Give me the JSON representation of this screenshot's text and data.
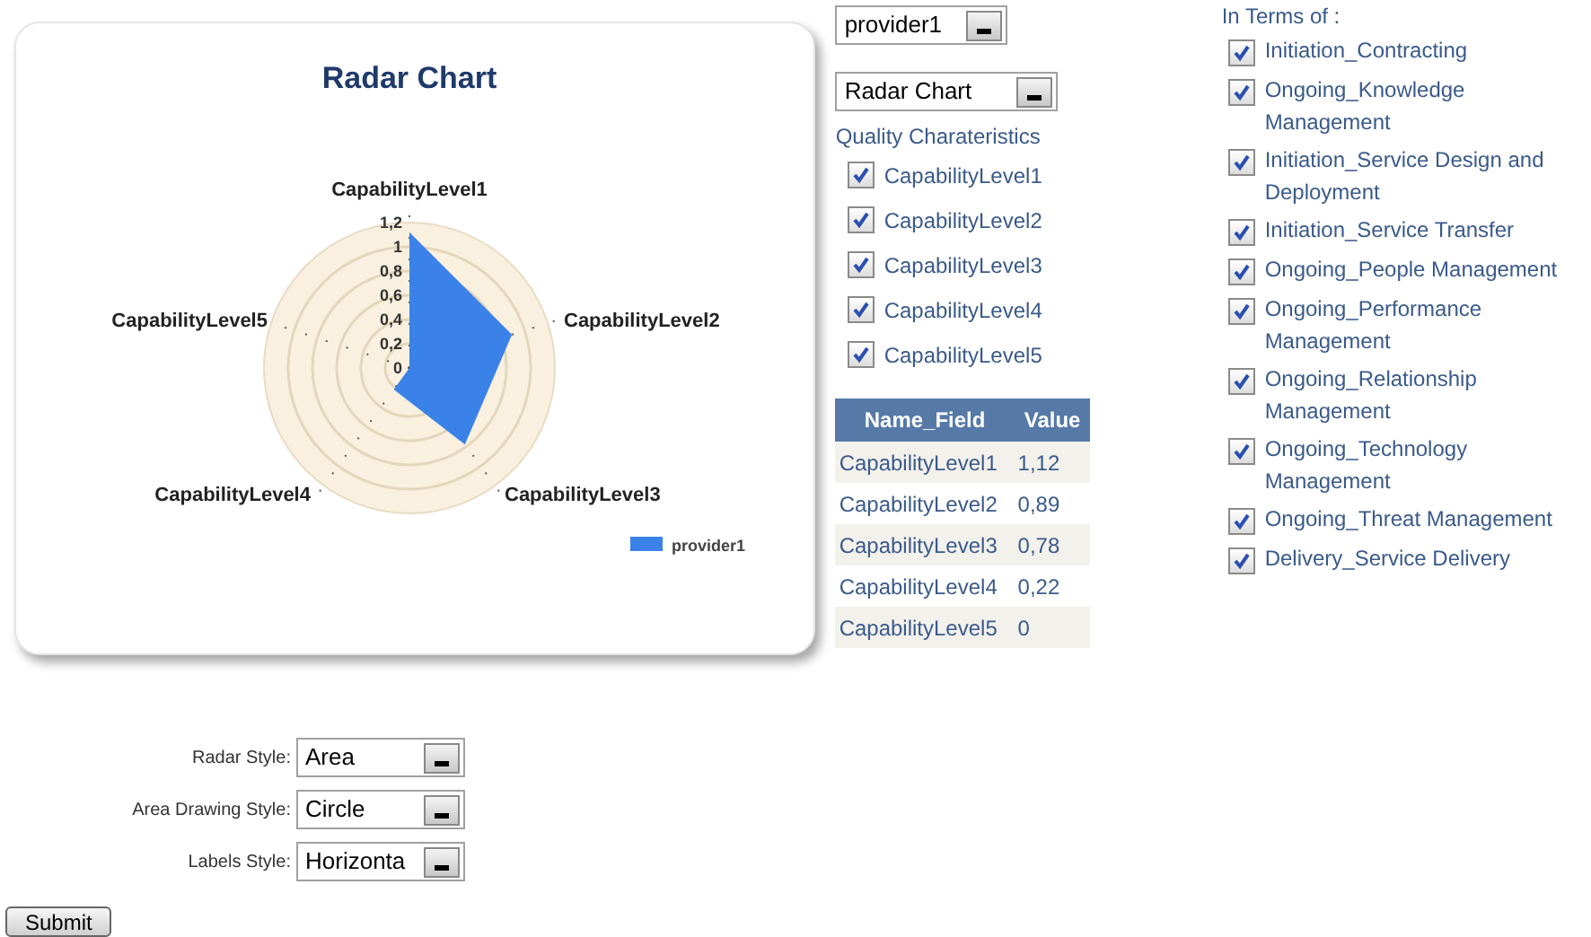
{
  "chart_card": {
    "title": "Radar Chart",
    "axis_labels": [
      "CapabilityLevel1",
      "CapabilityLevel5",
      "CapabilityLevel2",
      "CapabilityLevel4",
      "CapabilityLevel3"
    ],
    "tick_labels": [
      "1,2",
      "1",
      "0,8",
      "0,6",
      "0,4",
      "0,2",
      "0"
    ],
    "legend": {
      "name": "provider1",
      "color": "#3b82e8"
    }
  },
  "provider_select": {
    "value": "provider1"
  },
  "chart_type_select": {
    "value": "Radar Chart"
  },
  "quality": {
    "title": "Quality Charateristics",
    "items": [
      {
        "label": "CapabilityLevel1",
        "checked": true
      },
      {
        "label": "CapabilityLevel2",
        "checked": true
      },
      {
        "label": "CapabilityLevel3",
        "checked": true
      },
      {
        "label": "CapabilityLevel4",
        "checked": true
      },
      {
        "label": "CapabilityLevel5",
        "checked": true
      }
    ]
  },
  "table": {
    "columns": [
      "Name_Field",
      "Value"
    ],
    "rows": [
      [
        "CapabilityLevel1",
        "1,12"
      ],
      [
        "CapabilityLevel2",
        "0,89"
      ],
      [
        "CapabilityLevel3",
        "0,78"
      ],
      [
        "CapabilityLevel4",
        "0,22"
      ],
      [
        "CapabilityLevel5",
        "0"
      ]
    ]
  },
  "terms": {
    "title": "In Terms of :",
    "items": [
      {
        "label": "Initiation_Contracting",
        "checked": true
      },
      {
        "label": "Ongoing_Knowledge Management",
        "checked": true
      },
      {
        "label": "Initiation_Service Design and Deployment",
        "checked": true
      },
      {
        "label": "Initiation_Service Transfer",
        "checked": true
      },
      {
        "label": "Ongoing_People Management",
        "checked": true
      },
      {
        "label": "Ongoing_Performance Management",
        "checked": true
      },
      {
        "label": "Ongoing_Relationship Management",
        "checked": true
      },
      {
        "label": "Ongoing_Technology Management",
        "checked": true
      },
      {
        "label": "Ongoing_Threat Management",
        "checked": true
      },
      {
        "label": "Delivery_Service Delivery",
        "checked": true
      }
    ]
  },
  "style_form": [
    {
      "label": "Radar Style:",
      "value": "Area"
    },
    {
      "label": "Area Drawing Style:",
      "value": "Circle"
    },
    {
      "label": "Labels Style:",
      "value": "Horizonta"
    }
  ],
  "submit": "Submit"
}
